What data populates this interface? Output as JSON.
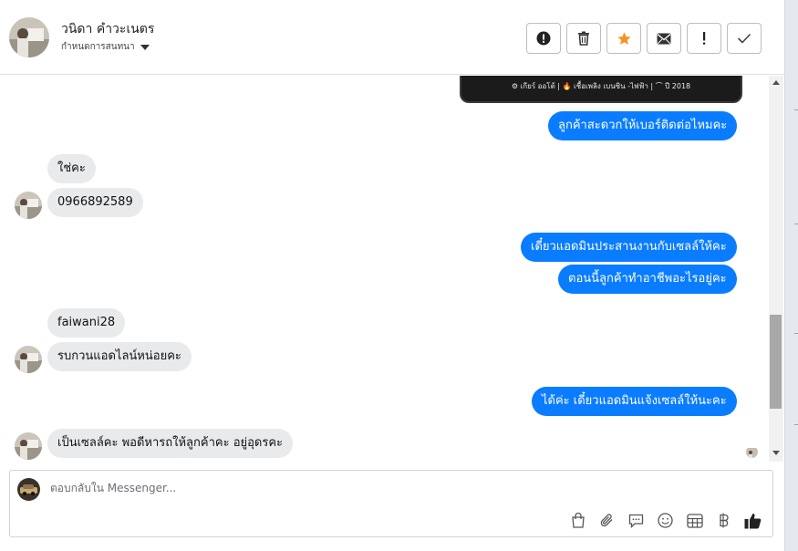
{
  "header": {
    "name": "วนิดา คำวะเนตร",
    "subtitle": "กำหนดการสนทนา"
  },
  "actions": [
    {
      "icon": "alert-circle-icon"
    },
    {
      "icon": "trash-icon"
    },
    {
      "icon": "star-icon"
    },
    {
      "icon": "envelope-icon"
    },
    {
      "icon": "exclamation-icon"
    },
    {
      "icon": "check-icon"
    }
  ],
  "product_card": {
    "specs": "⚙ เกียร์ ออโต้ | 🔥 เชื้อเพลิง เบนซิน -ไฟฟ้า | ⌒ ปี 2018"
  },
  "messages": [
    {
      "dir": "out",
      "text": "ลูกค้าสะดวกให้เบอร์ติดต่อไหมคะ"
    },
    {
      "dir": "in",
      "text": "ใช่คะ"
    },
    {
      "dir": "in",
      "text": "0966892589"
    },
    {
      "dir": "out",
      "text": "เดี๋ยวแอดมินประสานงานกับเซลล์ให้คะ"
    },
    {
      "dir": "out",
      "text": "ตอนนี้ลูกค้าทำอาชีพอะไรอยู่คะ"
    },
    {
      "dir": "in",
      "text": "faiwani28"
    },
    {
      "dir": "in",
      "text": "รบกวนแอดไลน์หน่อยคะ"
    },
    {
      "dir": "out",
      "text": "ได้ค่ะ เดี๋ยวแอดมินแจ้งเซลล์ให้นะคะ"
    },
    {
      "dir": "in",
      "text": "เป็นเซลล์คะ พอดีหารถให้ลูกค้าคะ อยู่อุดรคะ"
    }
  ],
  "composer": {
    "placeholder": "ตอบกลับใน Messenger..."
  },
  "tools": [
    {
      "icon": "shopping-bag-icon"
    },
    {
      "icon": "paperclip-icon"
    },
    {
      "icon": "chat-bubble-icon"
    },
    {
      "icon": "smiley-icon"
    },
    {
      "icon": "table-icon"
    },
    {
      "icon": "baht-icon"
    },
    {
      "icon": "thumbs-up-icon"
    }
  ],
  "colors": {
    "accent": "#0a7cff",
    "incoming_bubble": "#e9eaec",
    "star": "#f7931e"
  }
}
